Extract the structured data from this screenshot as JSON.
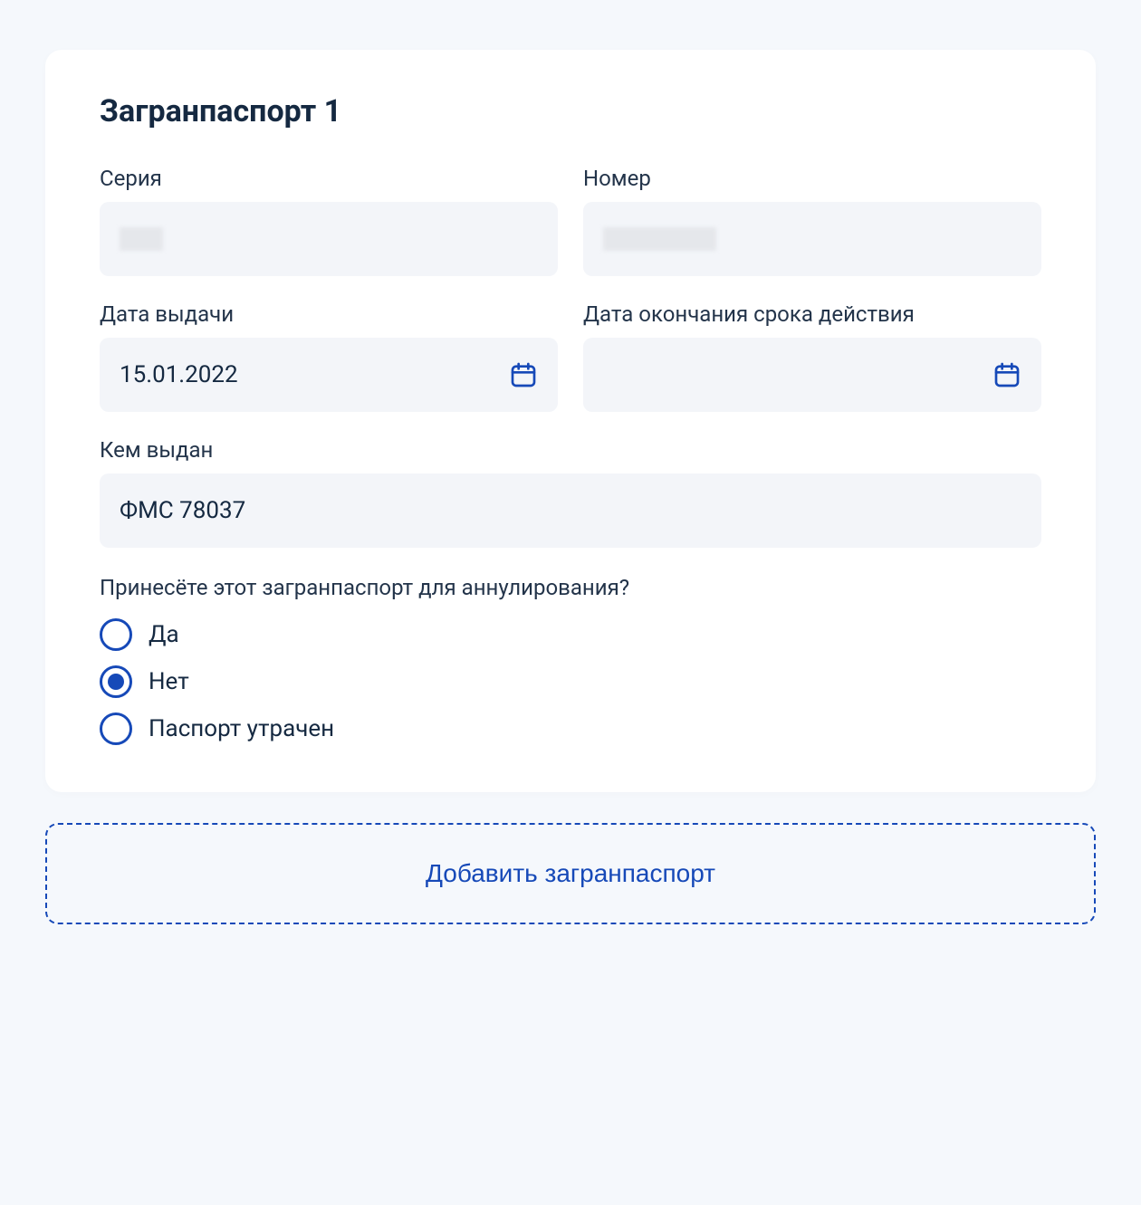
{
  "card": {
    "title": "Загранпаспорт 1",
    "fields": {
      "series_label": "Серия",
      "series_value": "",
      "number_label": "Номер",
      "number_value": "",
      "issue_date_label": "Дата выдачи",
      "issue_date_value": "15.01.2022",
      "expiry_date_label": "Дата окончания срока действия",
      "expiry_date_value": "",
      "issued_by_label": "Кем выдан",
      "issued_by_value": "ФМС 78037"
    },
    "question": {
      "text": "Принесёте этот загранпаспорт для аннулирования?",
      "options": [
        "Да",
        "Нет",
        "Паспорт утрачен"
      ],
      "selected_index": 1
    }
  },
  "add_button_label": "Добавить загранпаспорт",
  "colors": {
    "accent": "#1649b8",
    "bg": "#f5f8fc",
    "input_bg": "#f3f5f9"
  }
}
